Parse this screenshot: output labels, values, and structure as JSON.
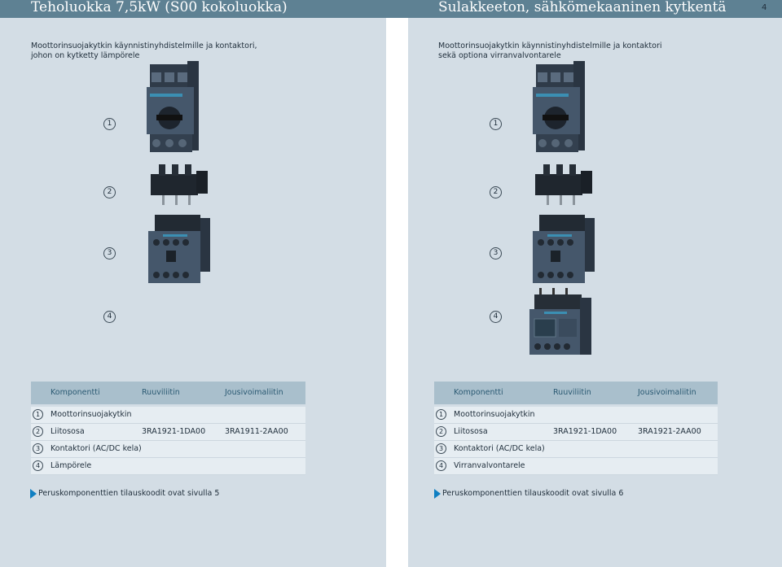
{
  "header": {
    "left_title": "Teholuokka 7,5kW (S00 kokoluokka)",
    "right_title": "Sulakkeeton, sähkömekaaninen kytkentä",
    "page_number": "4"
  },
  "left_page": {
    "subtitle_line1": "Moottorinsuojakytkin käynnistinyhdistelmille ja kontaktori,",
    "subtitle_line2": "johon on kytketty lämpörele",
    "callouts": [
      "1",
      "2",
      "3",
      "4"
    ],
    "table": {
      "headers": [
        "Komponentti",
        "Ruuviliitin",
        "Jousivoimaliitin"
      ],
      "rows": [
        {
          "num": "1",
          "component": "Moottorinsuojakytkin",
          "screw": "",
          "spring": ""
        },
        {
          "num": "2",
          "component": "Liitososa",
          "screw": "3RA1921-1DA00",
          "spring": "3RA1911-2AA00"
        },
        {
          "num": "3",
          "component": "Kontaktori (AC/DC kela)",
          "screw": "",
          "spring": ""
        },
        {
          "num": "4",
          "component": "Lämpörele",
          "screw": "",
          "spring": ""
        }
      ]
    },
    "footnote": "Peruskomponenttien tilauskoodit ovat sivulla 5"
  },
  "right_page": {
    "subtitle_line1": "Moottorinsuojakytkin käynnistinyhdistelmille ja kontaktori",
    "subtitle_line2": "sekä optiona virranvalvontarele",
    "callouts": [
      "1",
      "2",
      "3",
      "4"
    ],
    "table": {
      "headers": [
        "Komponentti",
        "Ruuviliitin",
        "Jousivoimaliitin"
      ],
      "rows": [
        {
          "num": "1",
          "component": "Moottorinsuojakytkin",
          "screw": "",
          "spring": ""
        },
        {
          "num": "2",
          "component": "Liitososa",
          "screw": "3RA1921-1DA00",
          "spring": "3RA1921-2AA00"
        },
        {
          "num": "3",
          "component": "Kontaktori (AC/DC kela)",
          "screw": "",
          "spring": ""
        },
        {
          "num": "4",
          "component": "Virranvalvontarele",
          "screw": "",
          "spring": ""
        }
      ]
    },
    "footnote": "Peruskomponenttien tilauskoodit ovat sivulla 6"
  },
  "colors": {
    "header_bar": "#5e8193",
    "page_bg": "#d3dde5",
    "table_header": "#a9bfcc",
    "table_row": "#e6edf2",
    "arrow": "#0f7fc2",
    "device_body": "#3f4f62"
  },
  "icons": [
    "circuit-breaker-device",
    "link-module-device",
    "contactor-device",
    "thermal-relay-device",
    "current-monitoring-relay-device",
    "arrow-right-icon"
  ]
}
